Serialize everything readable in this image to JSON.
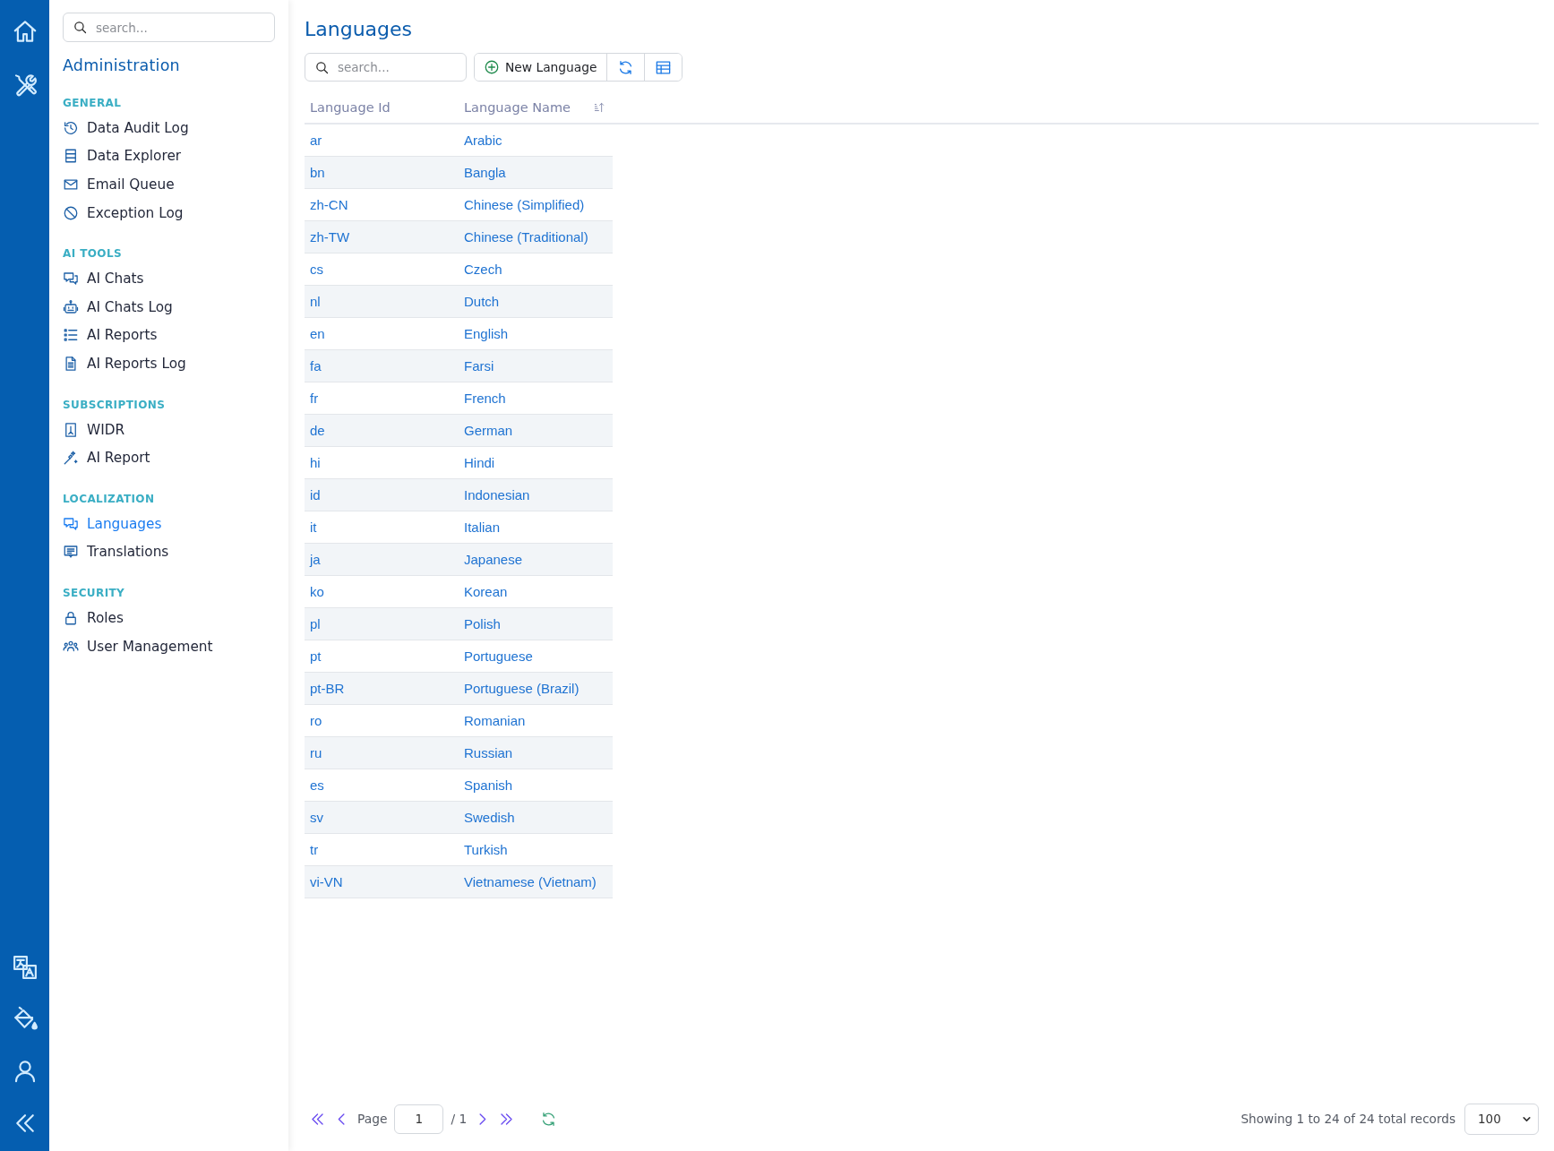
{
  "sidebar": {
    "search": {
      "placeholder": "search..."
    },
    "title": "Administration",
    "groups": [
      {
        "label": "GENERAL",
        "items": [
          {
            "label": "Data Audit Log",
            "selected": false
          },
          {
            "label": "Data Explorer",
            "selected": false
          },
          {
            "label": "Email Queue",
            "selected": false
          },
          {
            "label": "Exception Log",
            "selected": false
          }
        ]
      },
      {
        "label": "AI TOOLS",
        "items": [
          {
            "label": "AI Chats",
            "selected": false
          },
          {
            "label": "AI Chats Log",
            "selected": false
          },
          {
            "label": "AI Reports",
            "selected": false
          },
          {
            "label": "AI Reports Log",
            "selected": false
          }
        ]
      },
      {
        "label": "SUBSCRIPTIONS",
        "items": [
          {
            "label": "WIDR",
            "selected": false
          },
          {
            "label": "AI Report",
            "selected": false
          }
        ]
      },
      {
        "label": "LOCALIZATION",
        "items": [
          {
            "label": "Languages",
            "selected": true
          },
          {
            "label": "Translations",
            "selected": false
          }
        ]
      },
      {
        "label": "SECURITY",
        "items": [
          {
            "label": "Roles",
            "selected": false
          },
          {
            "label": "User Management",
            "selected": false
          }
        ]
      }
    ]
  },
  "page": {
    "title": "Languages",
    "search": {
      "placeholder": "search..."
    },
    "toolbar": {
      "new_button": "New Language"
    },
    "table": {
      "columns": [
        {
          "label": "Language Id",
          "sorted": false
        },
        {
          "label": "Language Name",
          "sorted": true
        }
      ],
      "rows": [
        {
          "id": "ar",
          "name": "Arabic"
        },
        {
          "id": "bn",
          "name": "Bangla"
        },
        {
          "id": "zh-CN",
          "name": "Chinese (Simplified)"
        },
        {
          "id": "zh-TW",
          "name": "Chinese (Traditional)"
        },
        {
          "id": "cs",
          "name": "Czech"
        },
        {
          "id": "nl",
          "name": "Dutch"
        },
        {
          "id": "en",
          "name": "English"
        },
        {
          "id": "fa",
          "name": "Farsi"
        },
        {
          "id": "fr",
          "name": "French"
        },
        {
          "id": "de",
          "name": "German"
        },
        {
          "id": "hi",
          "name": "Hindi"
        },
        {
          "id": "id",
          "name": "Indonesian"
        },
        {
          "id": "it",
          "name": "Italian"
        },
        {
          "id": "ja",
          "name": "Japanese"
        },
        {
          "id": "ko",
          "name": "Korean"
        },
        {
          "id": "pl",
          "name": "Polish"
        },
        {
          "id": "pt",
          "name": "Portuguese"
        },
        {
          "id": "pt-BR",
          "name": "Portuguese (Brazil)"
        },
        {
          "id": "ro",
          "name": "Romanian"
        },
        {
          "id": "ru",
          "name": "Russian"
        },
        {
          "id": "es",
          "name": "Spanish"
        },
        {
          "id": "sv",
          "name": "Swedish"
        },
        {
          "id": "tr",
          "name": "Turkish"
        },
        {
          "id": "vi-VN",
          "name": "Vietnamese (Vietnam)"
        }
      ]
    },
    "pagination": {
      "page_label": "Page",
      "page": "1",
      "page_total": "/ 1",
      "summary": "Showing 1 to 24 of 24 total records",
      "page_size": "100"
    }
  }
}
